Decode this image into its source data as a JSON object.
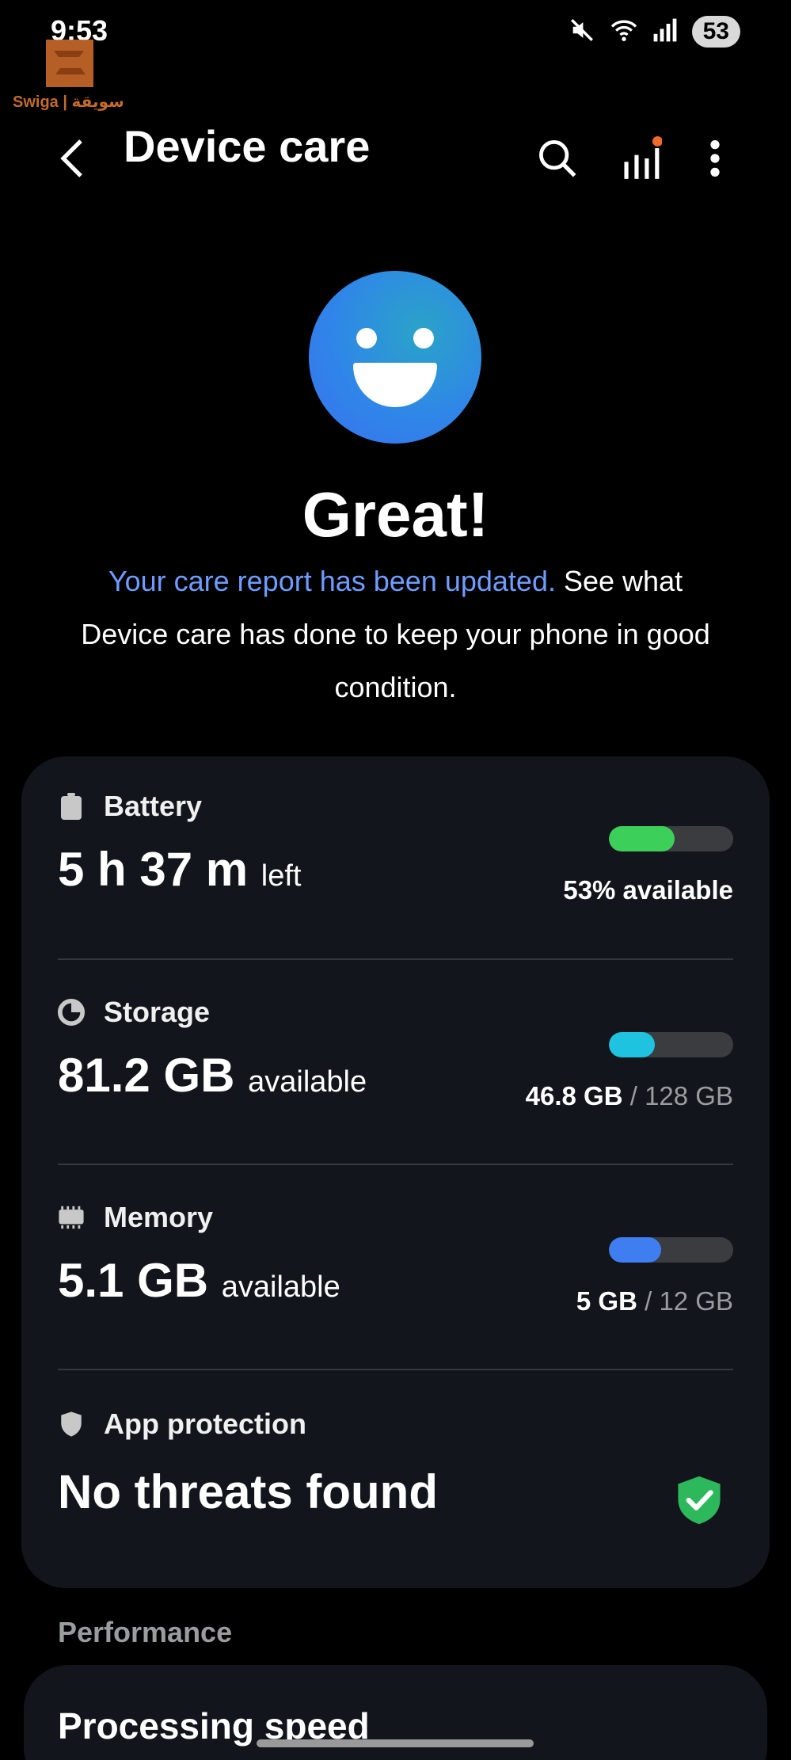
{
  "status_bar": {
    "time": "9:53",
    "battery_level": "53",
    "icons": [
      "mute-icon",
      "wifi-6-icon",
      "signal-icon"
    ]
  },
  "watermark": {
    "text": "Swiga | سويقة"
  },
  "header": {
    "title": "Device care",
    "back_icon": "chevron-left-icon",
    "actions": [
      "search-icon",
      "report-stats-icon",
      "more-options-icon"
    ]
  },
  "hero": {
    "title": "Great!",
    "link_text": "Your care report has been updated.",
    "desc_text": " See what Device care has done to keep your phone in good condition."
  },
  "battery": {
    "label": "Battery",
    "value": "5 h 37 m",
    "unit": "left",
    "status": "53% available",
    "fill_percent": 53,
    "color": "#3ccf5a"
  },
  "storage": {
    "label": "Storage",
    "value": "81.2 GB",
    "unit": "available",
    "used": "46.8 GB",
    "total": "128 GB",
    "fill_percent": 37,
    "color": "#1fc3e0"
  },
  "memory": {
    "label": "Memory",
    "value": "5.1 GB",
    "unit": "available",
    "used": "5 GB",
    "total": "12 GB",
    "fill_percent": 42,
    "color": "#3f7ef0"
  },
  "app_protection": {
    "label": "App protection",
    "value": "No threats found",
    "shield_color": "#2eb85c"
  },
  "performance": {
    "section_label": "Performance",
    "item_title": "Processing speed"
  },
  "slash": "/"
}
